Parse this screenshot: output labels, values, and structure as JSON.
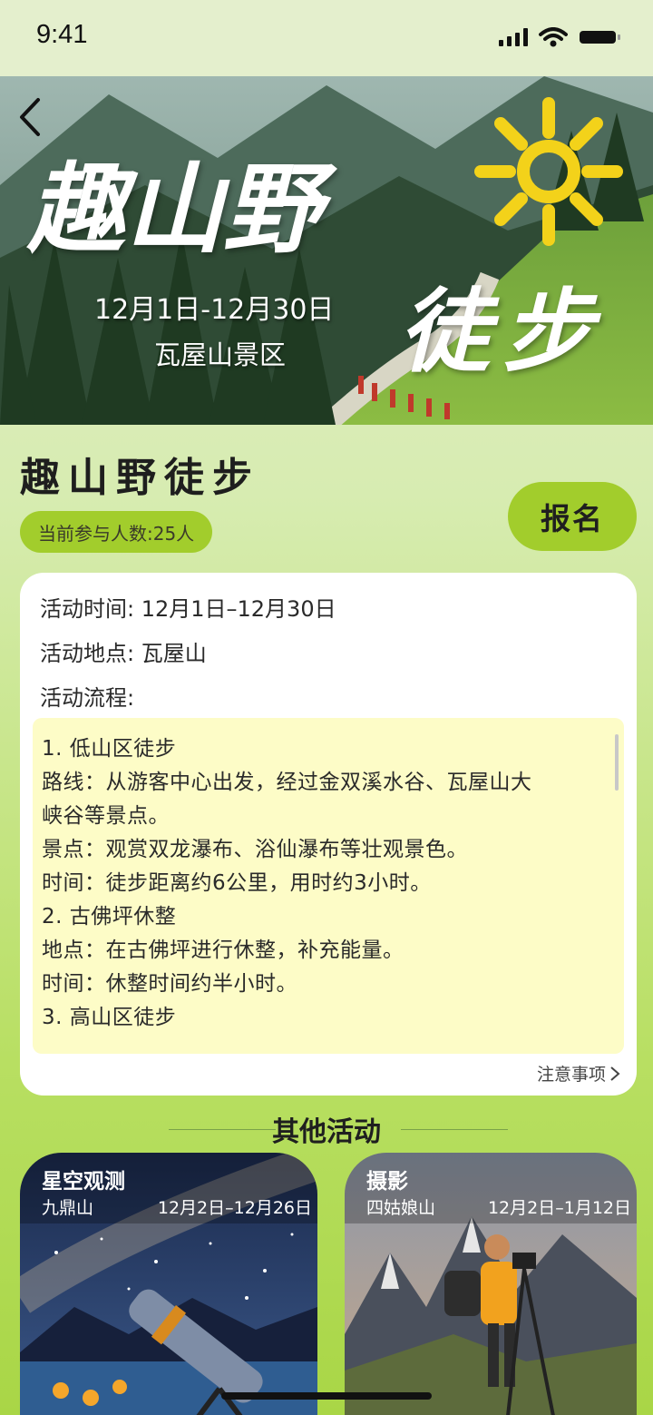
{
  "status": {
    "time": "9:41"
  },
  "hero": {
    "title_line1": "趣山野",
    "title_line2": "徒步",
    "date": "12月1日-12月30日",
    "place": "瓦屋山景区"
  },
  "event": {
    "title": "趣山野徒步",
    "participants": "当前参与人数:25人",
    "signup_label": "报名"
  },
  "info": {
    "time": "活动时间: 12月1日–12月30日",
    "location": "活动地点: 瓦屋山",
    "process_label": "活动流程:",
    "process": [
      "1. 低山区徒步",
      "路线：从游客中心出发，经过金双溪水谷、瓦屋山大",
      "峡谷等景点。",
      "景点：观赏双龙瀑布、浴仙瀑布等壮观景色。",
      "时间：徒步距离约6公里，用时约3小时。",
      "2. 古佛坪休整",
      "地点：在古佛坪进行休整，补充能量。",
      "时间：休整时间约半小时。",
      "3. 高山区徒步"
    ],
    "notes_link": "注意事项"
  },
  "others": {
    "section_title": "其他活动",
    "cards": [
      {
        "name": "星空观测",
        "place": "九鼎山",
        "date": "12月2日–12月26日"
      },
      {
        "name": "摄影",
        "place": "四姑娘山",
        "date": "12月2日–1月12日"
      }
    ]
  }
}
